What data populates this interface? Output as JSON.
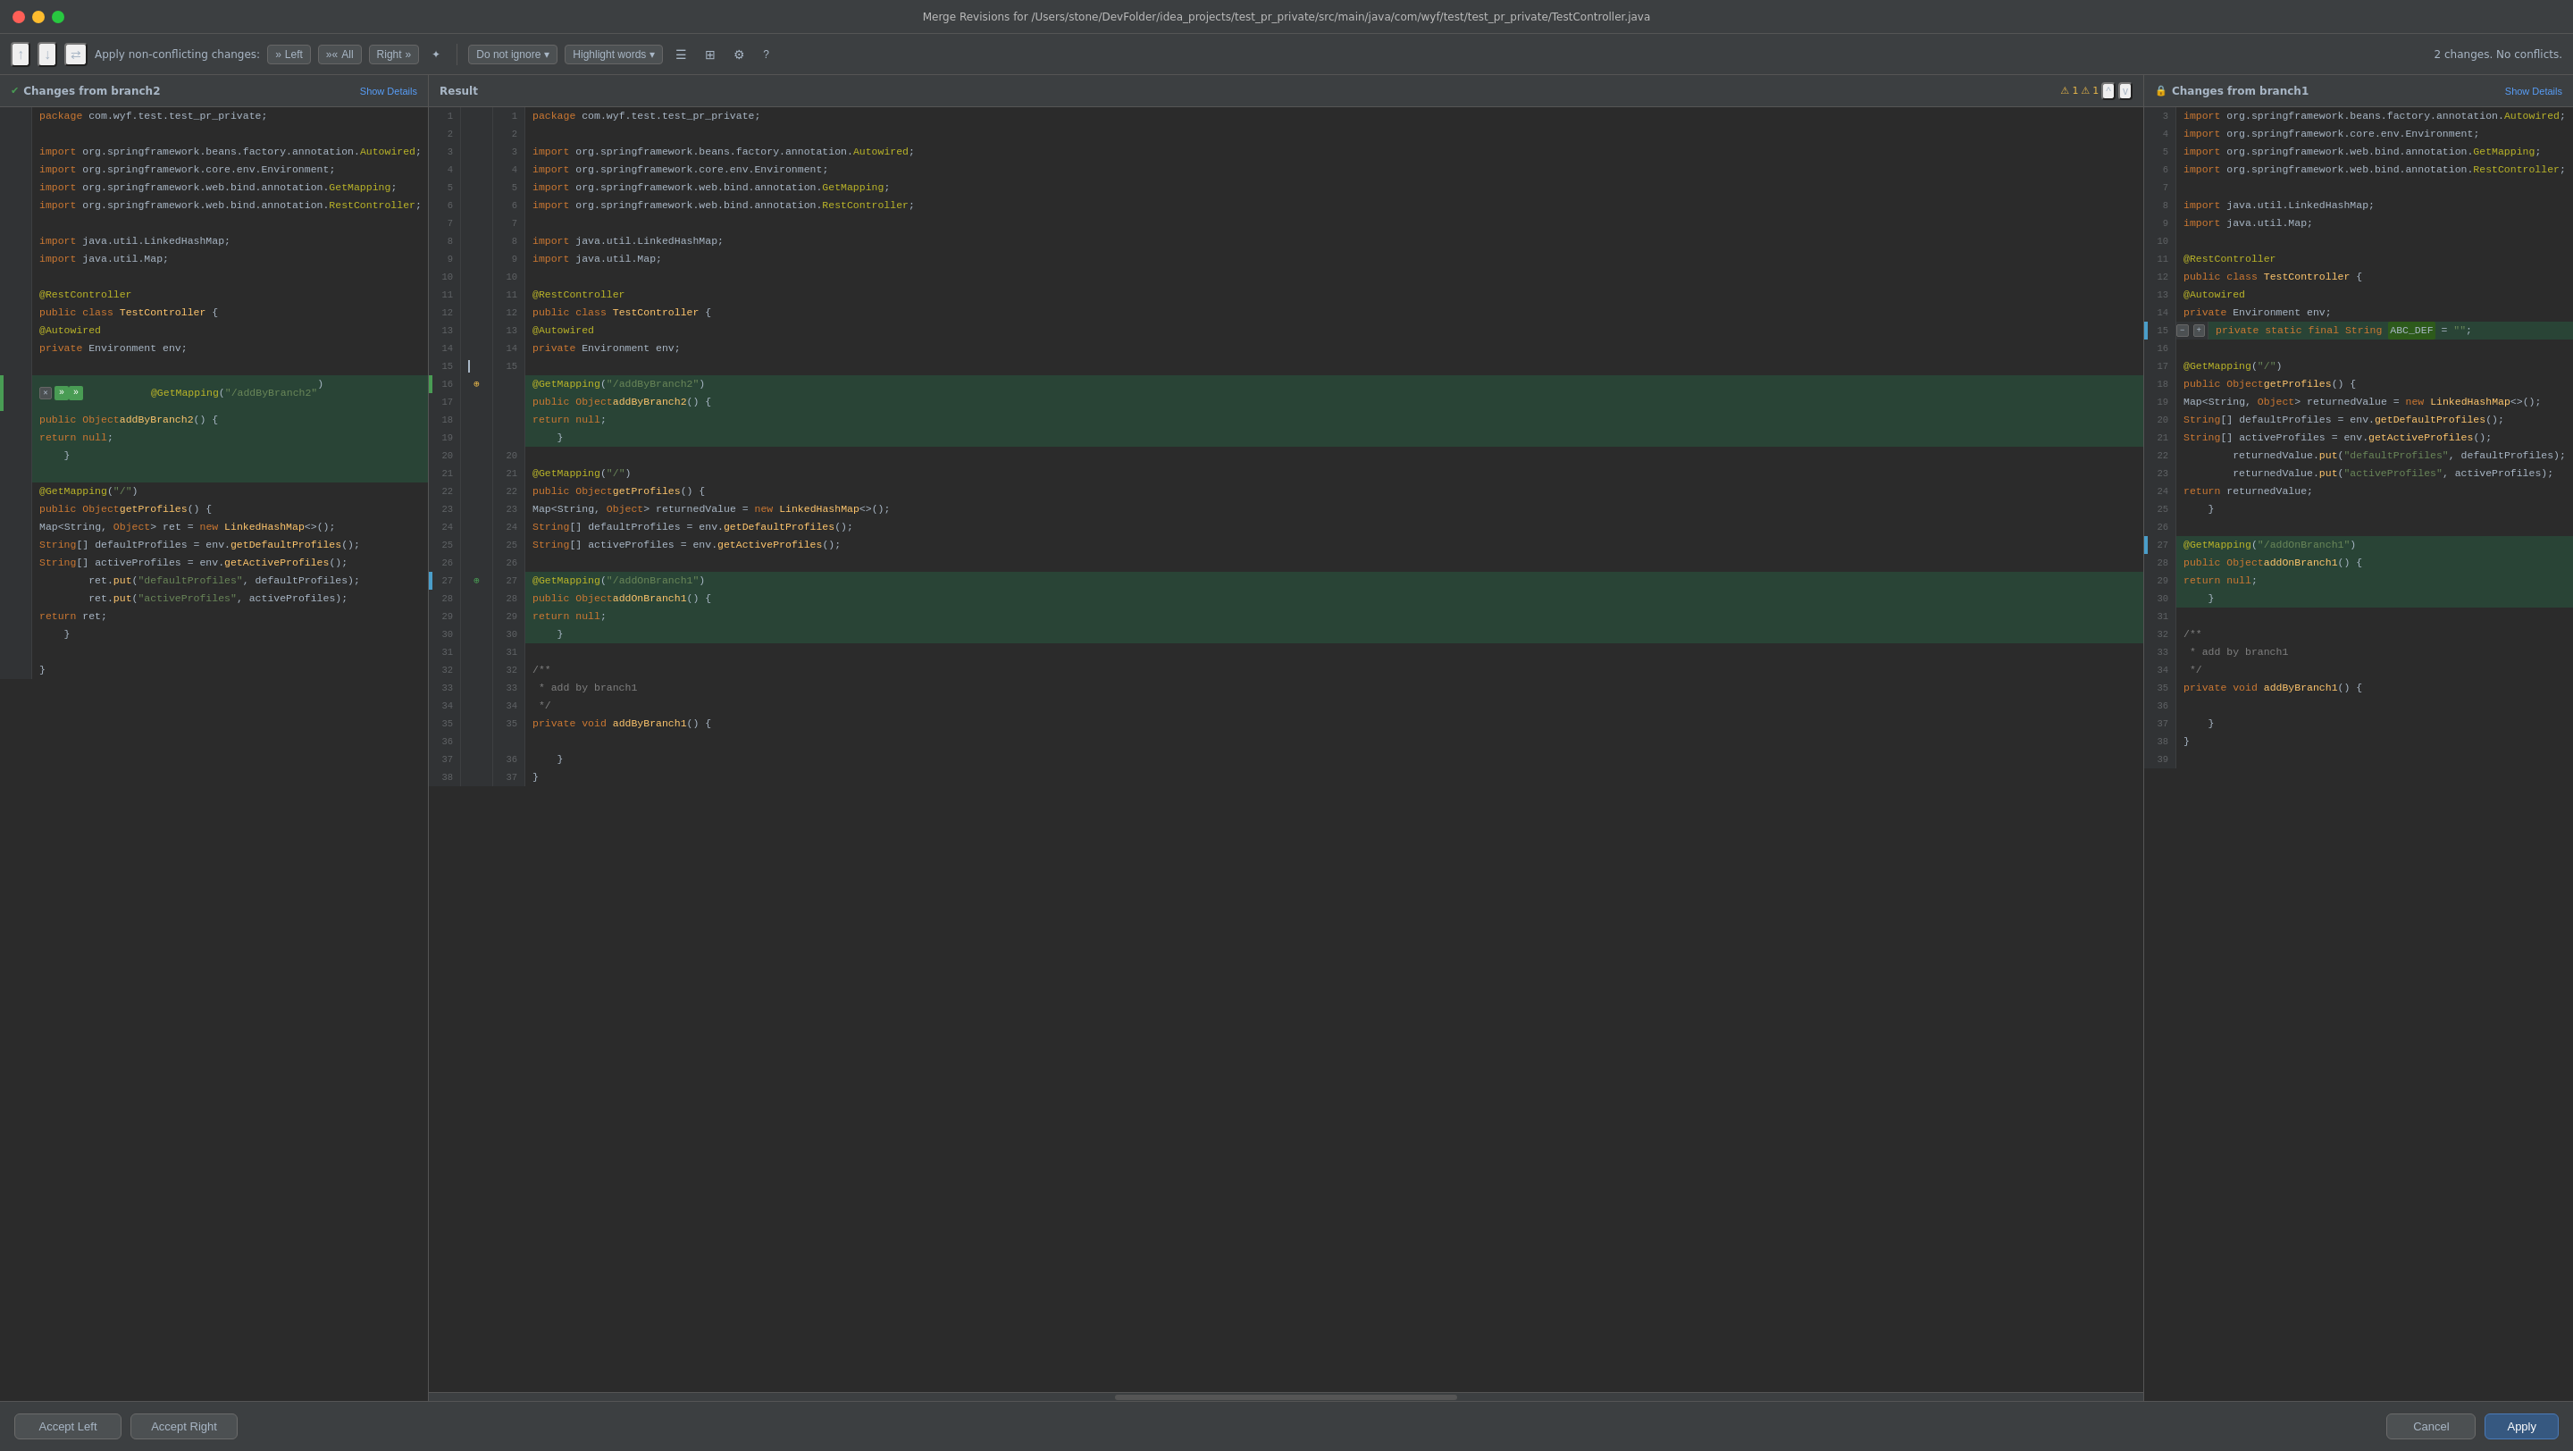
{
  "window": {
    "title": "Merge Revisions for /Users/stone/DevFolder/idea_projects/test_pr_private/src/main/java/com/wyf/test/test_pr_private/TestController.java"
  },
  "toolbar": {
    "apply_label": "Apply non-conflicting changes:",
    "left_btn": "Left",
    "all_btn": "All",
    "right_btn": "Right",
    "do_not_ignore": "Do not ignore",
    "highlight_words": "Highlight words",
    "status": "2 changes. No conflicts.",
    "help": "?"
  },
  "left_panel": {
    "title": "Changes from branch2",
    "show_details": "Show Details",
    "lines": [
      {
        "num": "",
        "content": "package com.wyf.test.test_pr_private;",
        "bg": ""
      },
      {
        "num": "",
        "content": "",
        "bg": ""
      },
      {
        "num": "",
        "content": "import org.springframework.beans.factory.annotation.Autowired;",
        "bg": ""
      },
      {
        "num": "",
        "content": "import org.springframework.core.env.Environment;",
        "bg": ""
      },
      {
        "num": "",
        "content": "import org.springframework.web.bind.annotation.GetMapping;",
        "bg": ""
      },
      {
        "num": "",
        "content": "import org.springframework.web.bind.annotation.RestController;",
        "bg": ""
      },
      {
        "num": "",
        "content": "",
        "bg": ""
      },
      {
        "num": "",
        "content": "import java.util.LinkedHashMap;",
        "bg": ""
      },
      {
        "num": "",
        "content": "import java.util.Map;",
        "bg": ""
      },
      {
        "num": "",
        "content": "",
        "bg": ""
      },
      {
        "num": "",
        "content": "@RestController",
        "bg": ""
      },
      {
        "num": "",
        "content": "public class TestController {",
        "bg": ""
      },
      {
        "num": "",
        "content": "    @Autowired",
        "bg": ""
      },
      {
        "num": "",
        "content": "    private Environment env;",
        "bg": ""
      },
      {
        "num": "",
        "content": "",
        "bg": ""
      },
      {
        "num": "",
        "content": "    @GetMapping(\"/addByBranch2\")",
        "bg": "green"
      },
      {
        "num": "",
        "content": "    public Object addByBranch2() {",
        "bg": "green"
      },
      {
        "num": "",
        "content": "        return null;",
        "bg": "green"
      },
      {
        "num": "",
        "content": "    }",
        "bg": "green"
      },
      {
        "num": "",
        "content": "",
        "bg": "green"
      },
      {
        "num": "",
        "content": "    @GetMapping(\"/\")",
        "bg": ""
      },
      {
        "num": "",
        "content": "    public Object getProfiles() {",
        "bg": ""
      },
      {
        "num": "",
        "content": "        Map<String, Object> ret = new LinkedHashMap<>();",
        "bg": ""
      },
      {
        "num": "",
        "content": "        String[] defaultProfiles = env.getDefaultProfiles();",
        "bg": ""
      },
      {
        "num": "",
        "content": "        String[] activeProfiles = env.getActiveProfiles();",
        "bg": ""
      },
      {
        "num": "",
        "content": "        ret.put(\"defaultProfiles\", defaultProfiles);",
        "bg": ""
      },
      {
        "num": "",
        "content": "        ret.put(\"activeProfiles\", activeProfiles);",
        "bg": ""
      },
      {
        "num": "",
        "content": "        return ret;",
        "bg": ""
      },
      {
        "num": "",
        "content": "    }",
        "bg": ""
      },
      {
        "num": "",
        "content": "",
        "bg": ""
      },
      {
        "num": "",
        "content": "}",
        "bg": ""
      }
    ]
  },
  "center_panel": {
    "title": "Result",
    "lines": []
  },
  "right_panel": {
    "title": "Changes from branch1",
    "show_details": "Show Details",
    "lines": []
  },
  "bottom": {
    "accept_left": "Accept Left",
    "accept_right": "Accept Right",
    "cancel": "Cancel",
    "apply": "Apply"
  }
}
